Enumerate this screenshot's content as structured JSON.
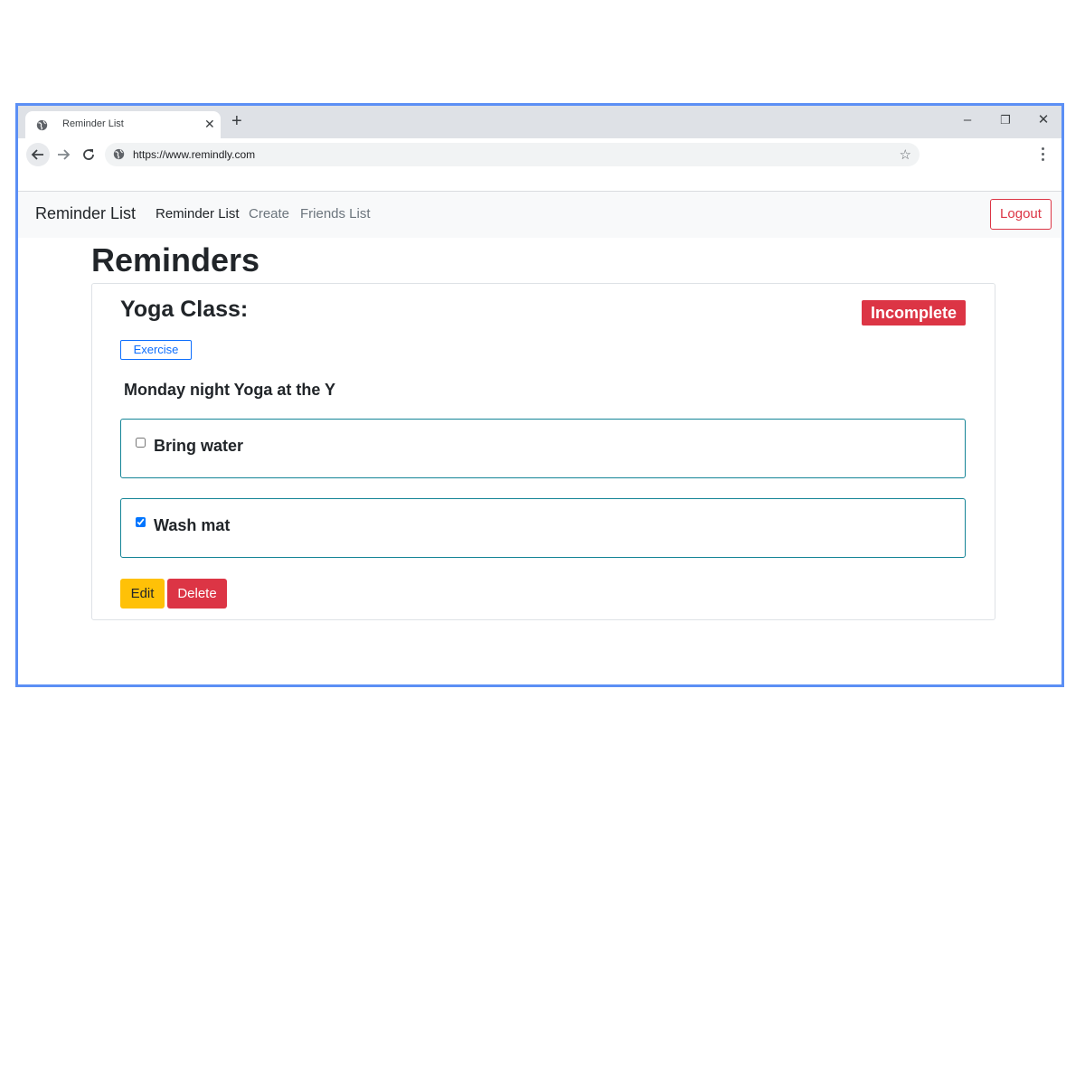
{
  "browser": {
    "tab_title": "Reminder List",
    "new_tab_symbol": "+",
    "tab_close_symbol": "✕",
    "url": "https://www.remindly.com",
    "window_controls": {
      "minimize": "–",
      "restore": "❐",
      "close": "✕"
    }
  },
  "navbar": {
    "brand": "Reminder List",
    "links": [
      {
        "label": "Reminder List",
        "active": true
      },
      {
        "label": "Create",
        "active": false
      },
      {
        "label": "Friends List",
        "active": false
      }
    ],
    "logout_label": "Logout"
  },
  "page": {
    "title": "Reminders"
  },
  "reminder": {
    "title": "Yoga Class:",
    "status": "Incomplete",
    "tag": "Exercise",
    "description": "Monday night Yoga at the Y",
    "subtasks": [
      {
        "label": "Bring water",
        "checked": false
      },
      {
        "label": "Wash mat",
        "checked": true
      }
    ],
    "edit_label": "Edit",
    "delete_label": "Delete"
  },
  "colors": {
    "window_border": "#5b8ff5",
    "danger": "#dc3545",
    "warning": "#ffc107",
    "primary": "#0d6efd",
    "subtask_border": "#138496"
  },
  "icons": [
    "globe-icon",
    "back-arrow-icon",
    "forward-arrow-icon",
    "reload-icon",
    "site-info-icon",
    "bookmark-star-icon",
    "more-vert-icon"
  ]
}
